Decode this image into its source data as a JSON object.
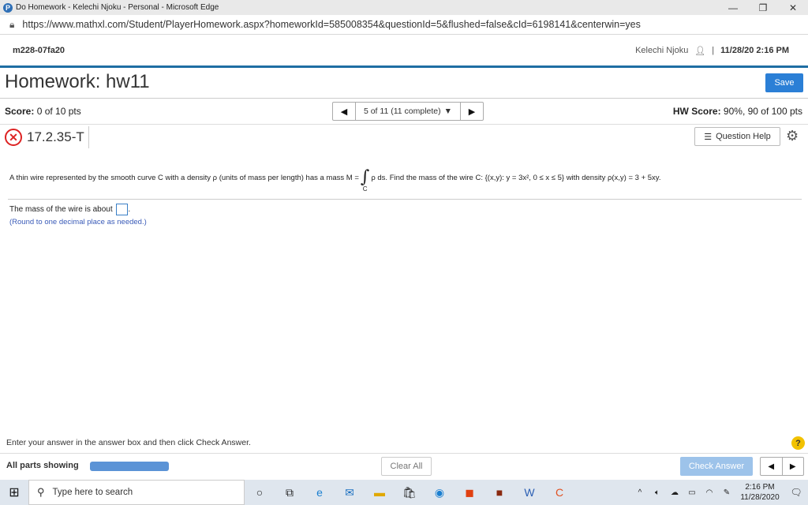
{
  "window": {
    "title": "Do Homework - Kelechi Njoku - Personal - Microsoft Edge",
    "url": "https://www.mathxl.com/Student/PlayerHomework.aspx?homeworkId=585008354&questionId=5&flushed=false&cId=6198141&centerwin=yes"
  },
  "header": {
    "course": "m228-07fa20",
    "user": "Kelechi Njoku",
    "datetime": "11/28/20 2:16 PM"
  },
  "page": {
    "title": "Homework: hw11",
    "save_label": "Save"
  },
  "score": {
    "label": "Score:",
    "value": "0 of 10 pts",
    "hw_label": "HW Score:",
    "hw_value": "90%, 90 of 100 pts"
  },
  "nav": {
    "position": "5 of 11 (11 complete)"
  },
  "question": {
    "id": "17.2.35-T",
    "help_label": "Question Help",
    "text_before": "A thin wire represented by the smooth curve C with a density ρ (units of mass per length) has a mass M =",
    "integral_sub": "C",
    "text_after": "ρ ds. Find the mass of the wire C: {(x,y): y = 3x², 0 ≤ x ≤ 5} with density ρ(x,y) = 3 + 5xy.",
    "answer_prefix": "The mass of the wire is about",
    "answer_suffix": ".",
    "answer_value": "",
    "note": "(Round to one decimal place as needed.)"
  },
  "footer": {
    "instructions": "Enter your answer in the answer box and then click Check Answer.",
    "parts_label": "All parts showing",
    "clear_label": "Clear All",
    "check_label": "Check Answer"
  },
  "taskbar": {
    "search_placeholder": "Type here to search",
    "time": "2:16 PM",
    "date": "11/28/2020"
  },
  "colors": {
    "accent": "#1f6ea3",
    "save_button": "#2b7fd6",
    "error": "#dd2222",
    "check_button": "#9dc3ea"
  }
}
